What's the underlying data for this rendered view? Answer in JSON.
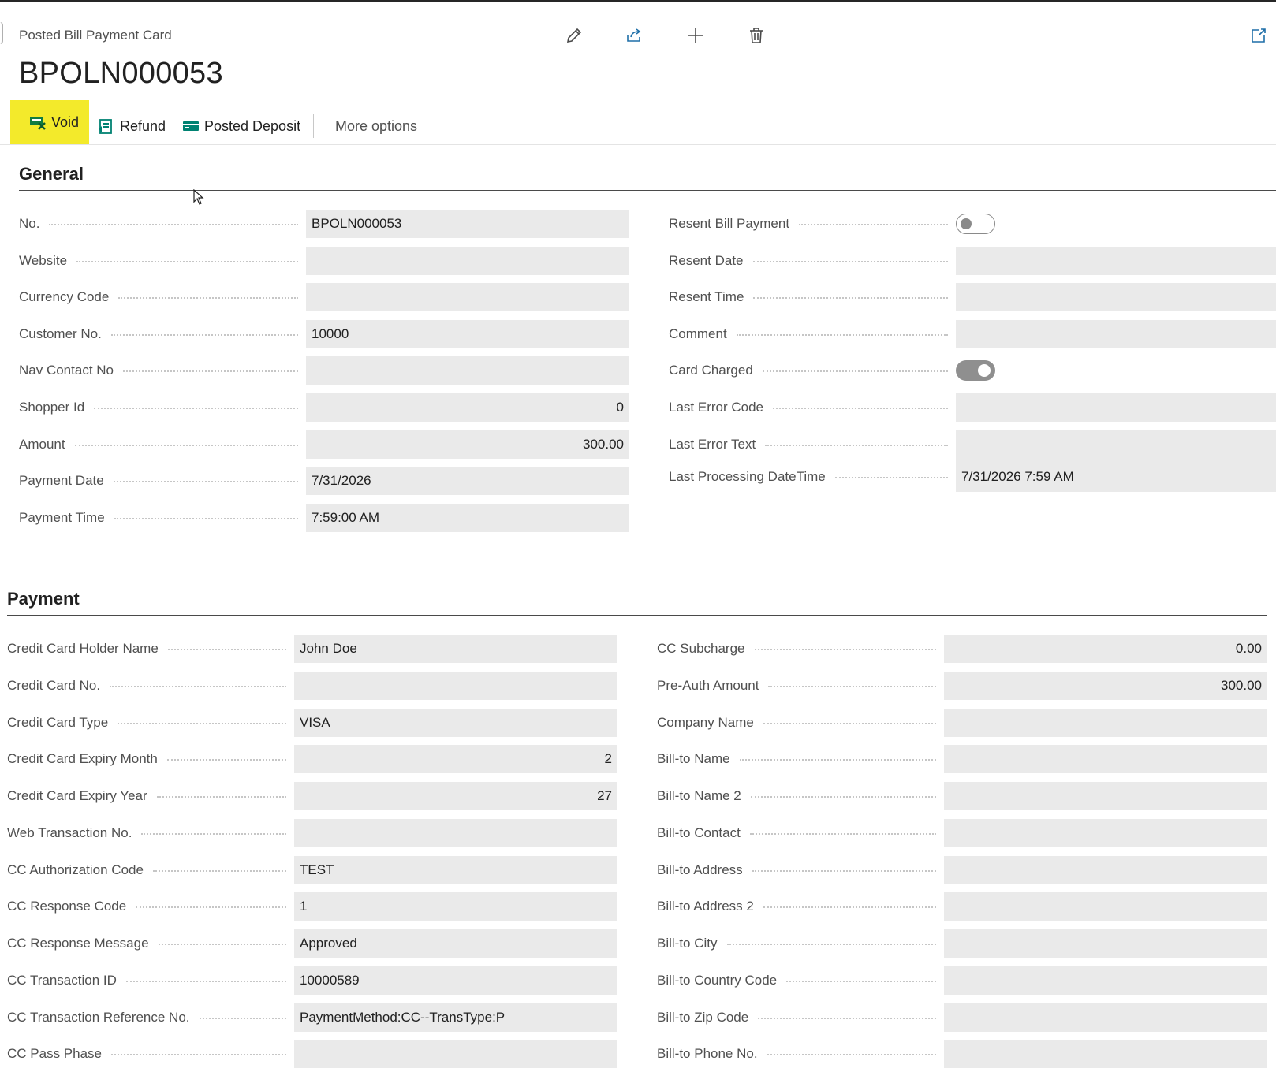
{
  "header": {
    "caption": "Posted Bill Payment Card",
    "record_no": "BPOLN000053",
    "icons": [
      "edit-icon",
      "share-icon",
      "add-icon",
      "delete-icon",
      "open-in-new-window-icon"
    ]
  },
  "actions": {
    "void": "Void",
    "refund": "Refund",
    "posted_deposit": "Posted Deposit",
    "more_options": "More options"
  },
  "colors": {
    "highlight": "#f3ea2b",
    "field_bg": "#eaeaea",
    "accent_green": "#008272"
  },
  "general": {
    "title": "General",
    "left": [
      {
        "label": "No.",
        "value": "BPOLN000053",
        "align": "left"
      },
      {
        "label": "Website",
        "value": "",
        "align": "left"
      },
      {
        "label": "Currency Code",
        "value": "",
        "align": "left"
      },
      {
        "label": "Customer No.",
        "value": "10000",
        "align": "left"
      },
      {
        "label": "Nav Contact No",
        "value": "",
        "align": "left"
      },
      {
        "label": "Shopper Id",
        "value": "0",
        "align": "right"
      },
      {
        "label": "Amount",
        "value": "300.00",
        "align": "right"
      },
      {
        "label": "Payment Date",
        "value": "7/31/2026",
        "align": "left"
      },
      {
        "label": "Payment Time",
        "value": "7:59:00 AM",
        "align": "left"
      }
    ],
    "right": [
      {
        "label": "Resent Bill Payment",
        "type": "toggle",
        "checked": false
      },
      {
        "label": "Resent Date",
        "value": ""
      },
      {
        "label": "Resent Time",
        "value": ""
      },
      {
        "label": "Comment",
        "value": ""
      },
      {
        "label": "Card Charged",
        "type": "toggle",
        "checked": true
      },
      {
        "label": "Last Error Code",
        "value": ""
      },
      {
        "label": "Last Error Text",
        "value": "",
        "multiline": true
      },
      {
        "label": "Last Processing DateTime",
        "value": "7/31/2026 7:59 AM"
      }
    ]
  },
  "payment": {
    "title": "Payment",
    "left": [
      {
        "label": "Credit Card Holder Name",
        "value": "John Doe",
        "align": "left"
      },
      {
        "label": "Credit Card No.",
        "value": "",
        "align": "left"
      },
      {
        "label": "Credit Card Type",
        "value": "VISA",
        "align": "left"
      },
      {
        "label": "Credit Card Expiry Month",
        "value": "2",
        "align": "right"
      },
      {
        "label": "Credit Card Expiry Year",
        "value": "27",
        "align": "right"
      },
      {
        "label": "Web Transaction No.",
        "value": "",
        "align": "left"
      },
      {
        "label": "CC Authorization Code",
        "value": "TEST",
        "align": "left"
      },
      {
        "label": "CC Response Code",
        "value": "1",
        "align": "left"
      },
      {
        "label": "CC Response Message",
        "value": "Approved",
        "align": "left"
      },
      {
        "label": "CC Transaction ID",
        "value": "10000589",
        "align": "left"
      },
      {
        "label": "CC Transaction Reference No.",
        "value": "PaymentMethod:CC--TransType:P",
        "align": "left"
      },
      {
        "label": "CC Pass Phase",
        "value": "",
        "align": "left"
      }
    ],
    "right": [
      {
        "label": "CC Subcharge",
        "value": "0.00",
        "align": "right"
      },
      {
        "label": "Pre-Auth Amount",
        "value": "300.00",
        "align": "right"
      },
      {
        "label": "Company Name",
        "value": "",
        "align": "left"
      },
      {
        "label": "Bill-to Name",
        "value": "",
        "align": "left"
      },
      {
        "label": "Bill-to Name 2",
        "value": "",
        "align": "left"
      },
      {
        "label": "Bill-to Contact",
        "value": "",
        "align": "left"
      },
      {
        "label": "Bill-to Address",
        "value": "",
        "align": "left"
      },
      {
        "label": "Bill-to Address 2",
        "value": "",
        "align": "left"
      },
      {
        "label": "Bill-to City",
        "value": "",
        "align": "left"
      },
      {
        "label": "Bill-to Country Code",
        "value": "",
        "align": "left"
      },
      {
        "label": "Bill-to Zip Code",
        "value": "",
        "align": "left"
      },
      {
        "label": "Bill-to Phone No.",
        "value": "",
        "align": "left"
      }
    ]
  }
}
